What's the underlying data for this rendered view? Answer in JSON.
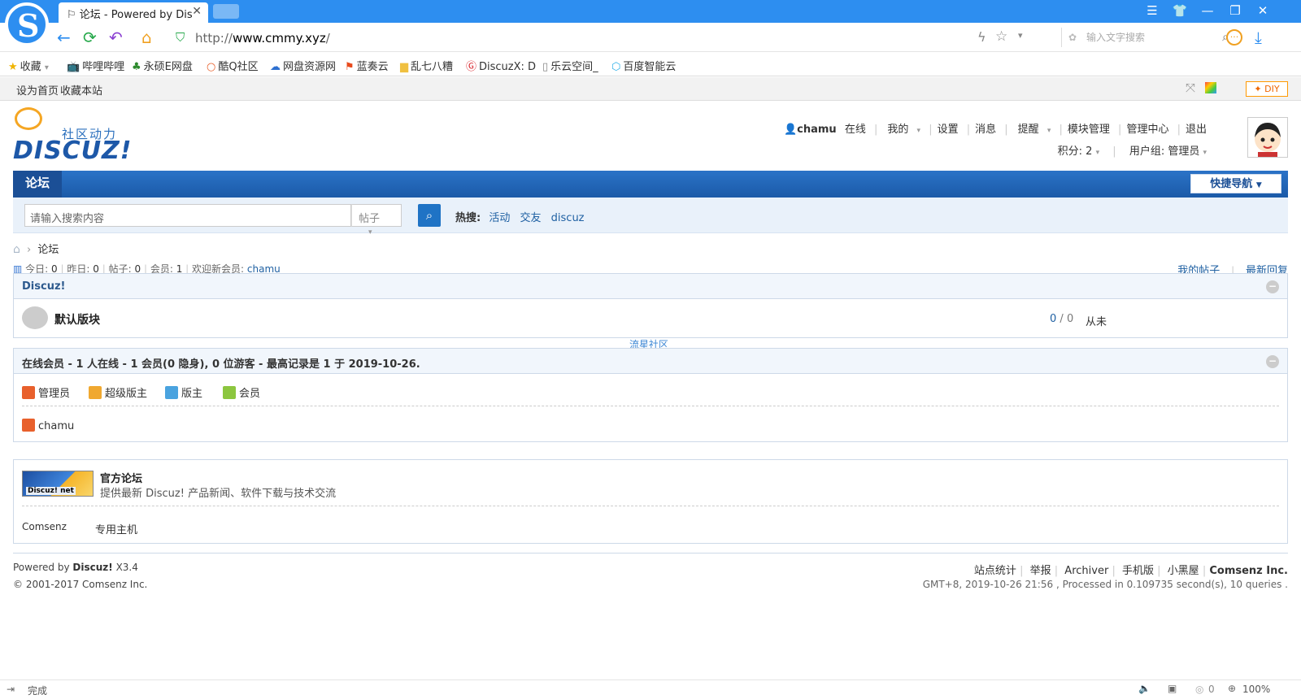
{
  "browser": {
    "tab_title": "论坛 - Powered by Dis",
    "tab_close": "✕",
    "url_prefix": "http://",
    "url_domain": "www.cmmy.xyz",
    "url_suffix": "/",
    "search_placeholder": "输入文字搜索",
    "status_text": "完成",
    "zoom": "100%",
    "status_count": "0"
  },
  "bookmarks": [
    {
      "label": "收藏",
      "icon": "star-icon"
    },
    {
      "label": "哔哩哔哩",
      "icon": "bilibili-icon"
    },
    {
      "label": "永硕E网盘",
      "icon": "tree-icon"
    },
    {
      "label": "酷Q社区",
      "icon": "q-icon"
    },
    {
      "label": "网盘资源网",
      "icon": "cloud-icon"
    },
    {
      "label": "蓝奏云",
      "icon": "flag-icon"
    },
    {
      "label": "乱七八糟",
      "icon": "folder-icon"
    },
    {
      "label": "DiscuzX: D",
      "icon": "discuz-icon"
    },
    {
      "label": "乐云空间_",
      "icon": "page-icon"
    },
    {
      "label": "百度智能云",
      "icon": "baidu-cloud-icon"
    }
  ],
  "topbar": {
    "set_home": "设为首页",
    "bookmark_site": "收藏本站",
    "diy": "DIY"
  },
  "brand": {
    "slogan": "社区动力",
    "wordmark": "DISCUZ!"
  },
  "usermenu": {
    "username": "chamu",
    "status": "在线",
    "my": "我的",
    "settings": "设置",
    "messages": "消息",
    "reminders": "提醒",
    "module_mgmt": "模块管理",
    "admin_center": "管理中心",
    "logout": "退出",
    "points": "积分: 2",
    "usergroup": "用户组: 管理员"
  },
  "nav": {
    "forum": "论坛",
    "quicknav": "快捷导航"
  },
  "search": {
    "placeholder": "请输入搜索内容",
    "type": "帖子",
    "hot_label": "热搜:",
    "hot": [
      "活动",
      "交友",
      "discuz"
    ]
  },
  "breadcrumb": {
    "current": "论坛"
  },
  "stats": {
    "today_label": "今日:",
    "today": "0",
    "yesterday_label": "昨日:",
    "yesterday": "0",
    "posts_label": "帖子:",
    "posts": "0",
    "members_label": "会员:",
    "members": "1",
    "welcome_label": "欢迎新会员:",
    "newest_member": "chamu",
    "my_posts": "我的帖子",
    "latest_reply": "最新回复"
  },
  "category": {
    "title": "Discuz!",
    "forum_name": "默认版块",
    "threads": "0",
    "slash": "/",
    "posts": "0",
    "last_post": "从未"
  },
  "float_link": "流星社区",
  "online": {
    "title": "在线会员 - 1 人在线 - 1 会员(0 隐身), 0 位游客 - 最高记录是 1 于 2019-10-26.",
    "groups": [
      {
        "label": "管理员",
        "color": "#e8602c"
      },
      {
        "label": "超级版主",
        "color": "#f0a830"
      },
      {
        "label": "版主",
        "color": "#4aa3df"
      },
      {
        "label": "会员",
        "color": "#8cc63f"
      }
    ],
    "user": "chamu"
  },
  "links": {
    "official_name": "官方论坛",
    "official_desc": "提供最新 Discuz! 产品新闻、软件下载与技术交流",
    "logo_text": "Discuz! net",
    "text_links": [
      "Comsenz",
      "专用主机"
    ]
  },
  "footer": {
    "powered_prefix": "Powered by",
    "powered_name": "Discuz!",
    "version": "X3.4",
    "copyright": "© 2001-2017 Comsenz Inc.",
    "links": [
      "站点统计",
      "举报",
      "Archiver",
      "手机版",
      "小黑屋"
    ],
    "company": "Comsenz Inc.",
    "timing": "GMT+8, 2019-10-26 21:56 , Processed in 0.109735 second(s), 10 queries ."
  },
  "colors": {
    "browser_blue": "#2d8ef0",
    "nav_blue": "#1b5aa8",
    "link_blue": "#2061a3"
  }
}
